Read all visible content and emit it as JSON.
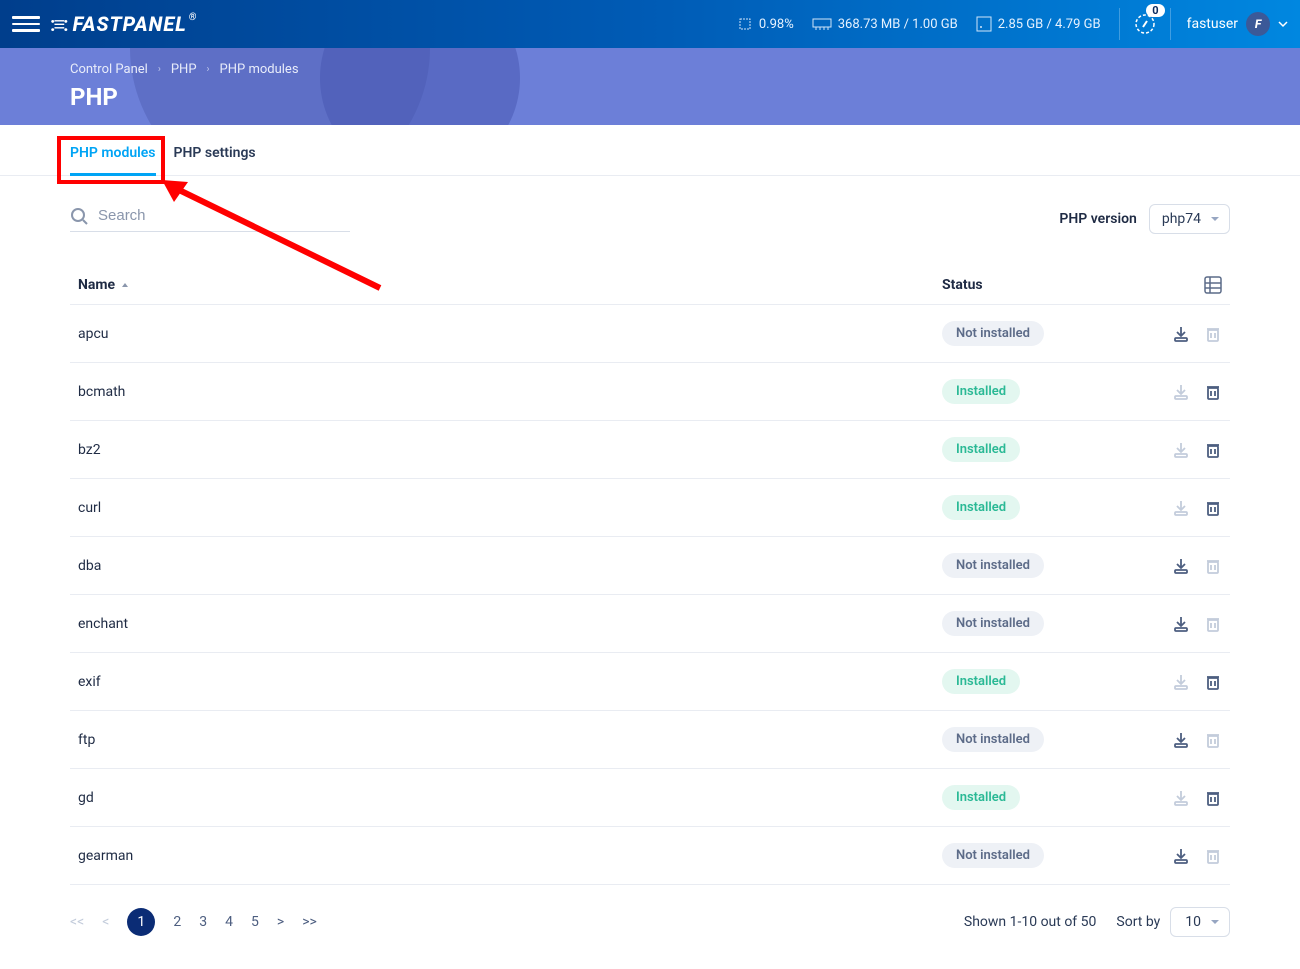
{
  "top": {
    "logo": "FASTPANEL",
    "cpu": "0.98%",
    "ram": "368.73 MB / 1.00 GB",
    "disk": "2.85 GB / 4.79 GB",
    "notif": "0",
    "user": "fastuser",
    "avatar": "F"
  },
  "header": {
    "crumb1": "Control Panel",
    "crumb2": "PHP",
    "crumb3": "PHP modules",
    "title": "PHP"
  },
  "tabs": {
    "modules": "PHP modules",
    "settings": "PHP settings"
  },
  "search": {
    "placeholder": "Search"
  },
  "version": {
    "label": "PHP version",
    "value": "php74"
  },
  "table": {
    "col_name": "Name",
    "col_status": "Status",
    "inst": "Installed",
    "ninst": "Not installed"
  },
  "rows": [
    {
      "name": "apcu",
      "installed": false
    },
    {
      "name": "bcmath",
      "installed": true
    },
    {
      "name": "bz2",
      "installed": true
    },
    {
      "name": "curl",
      "installed": true
    },
    {
      "name": "dba",
      "installed": false
    },
    {
      "name": "enchant",
      "installed": false
    },
    {
      "name": "exif",
      "installed": true
    },
    {
      "name": "ftp",
      "installed": false
    },
    {
      "name": "gd",
      "installed": true
    },
    {
      "name": "gearman",
      "installed": false
    }
  ],
  "pagination": {
    "pages": [
      "1",
      "2",
      "3",
      "4",
      "5"
    ],
    "shown": "Shown 1-10 out of 50",
    "sortby": "Sort by",
    "perpage": "10"
  }
}
